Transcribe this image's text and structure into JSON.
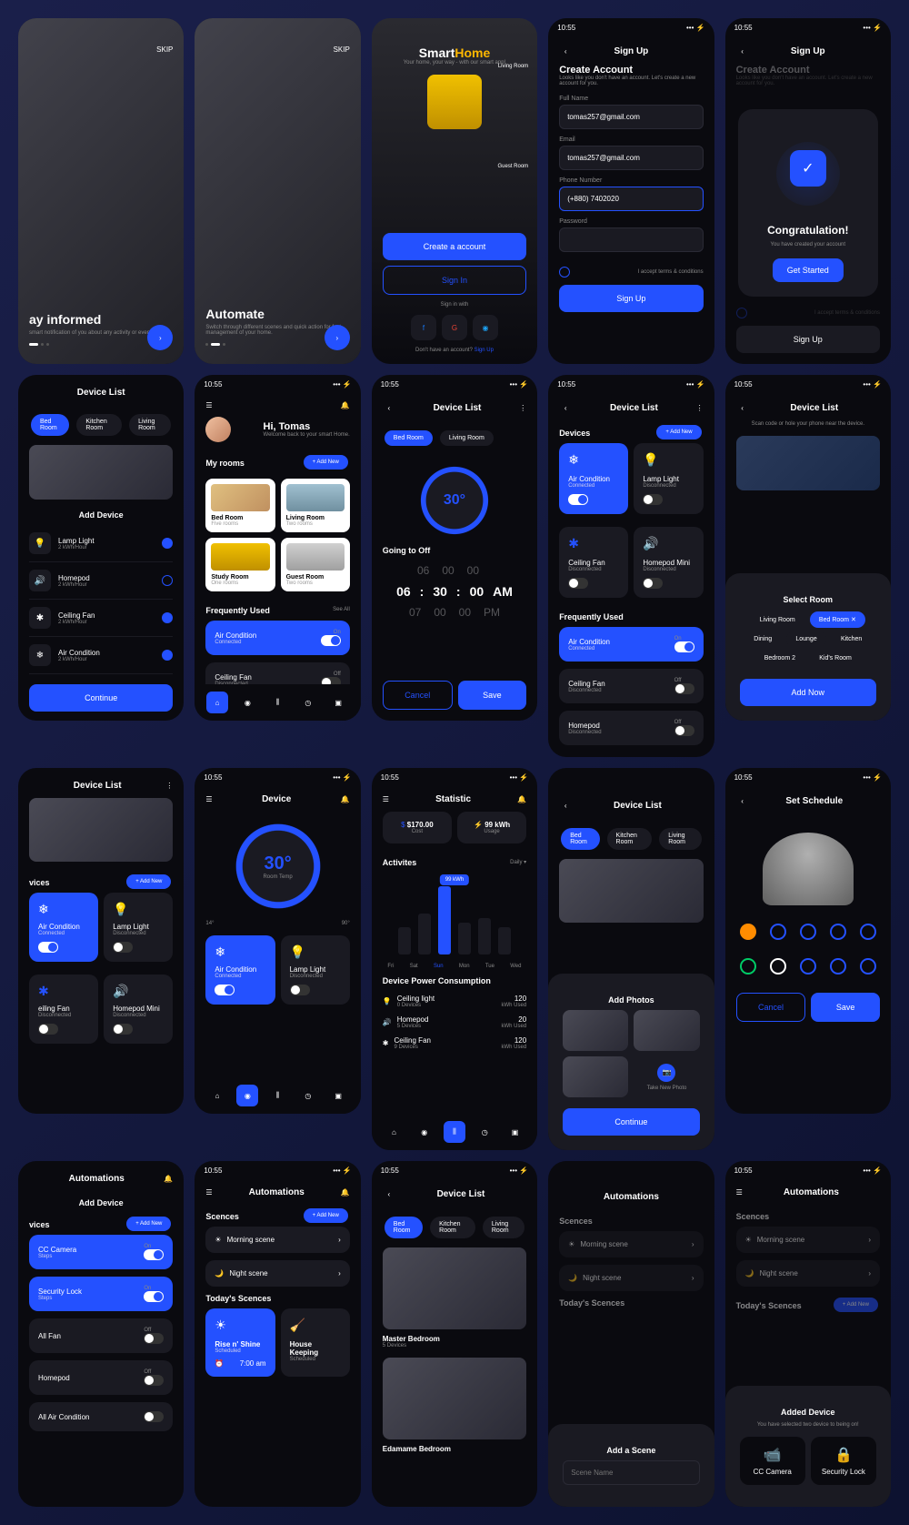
{
  "time": "10:55",
  "onboard1": {
    "skip": "SKIP",
    "title": "ay informed",
    "sub": "smart notification of you about any activity or events"
  },
  "onboard2": {
    "skip": "SKIP",
    "title": "Automate",
    "sub": "Switch through different scenes and quick action for fast management of your home."
  },
  "welcome": {
    "brand1": "Smart",
    "brand2": "Home",
    "tagline": "Your home, your way - with our smart app!",
    "room1": "Living Room",
    "room2": "Guest Room",
    "create": "Create a account",
    "signin": "Sign In",
    "signwith": "Sign in with",
    "noacct": "Don't have an account?",
    "signup": "Sign Up"
  },
  "signup": {
    "title": "Sign Up",
    "heading": "Create Account",
    "sub": "Looks like you don't have an account. Let's create a new account for you.",
    "name_label": "Full Name",
    "name_val": "tomas257@gmail.com",
    "email_label": "Email",
    "email_val": "tomas257@gmail.com",
    "phone_label": "Phone Number",
    "phone_val": "(+880) 7402020",
    "pwd_label": "Password",
    "terms": "I accept terms & conditions",
    "btn": "Sign Up"
  },
  "congrats": {
    "title": "Congratulation!",
    "sub": "You have created your account",
    "btn": "Get Started"
  },
  "devlist": {
    "title": "Device List",
    "addnew": "Add New",
    "continue": "Continue",
    "tabs": [
      "Bed Room",
      "Kitchen Room",
      "Living Room"
    ]
  },
  "adddevice": {
    "title": "Add Device",
    "devices": [
      {
        "name": "Lamp Light",
        "sub": "2 kWh/Hour"
      },
      {
        "name": "Homepod",
        "sub": "2 kWh/Hour"
      },
      {
        "name": "Ceiling Fan",
        "sub": "2 kWh/Hour"
      },
      {
        "name": "Air Condition",
        "sub": "2 kWh/Hour"
      }
    ]
  },
  "home": {
    "greeting": "Hi, Tomas",
    "welcome": "Welcome back to your smart Home.",
    "myrooms": "My rooms",
    "rooms": [
      {
        "name": "Bed Room",
        "sub": "Five rooms"
      },
      {
        "name": "Living Room",
        "sub": "Two rooms"
      },
      {
        "name": "Study Room",
        "sub": "One rooms"
      },
      {
        "name": "Guest Room",
        "sub": "Two rooms"
      }
    ],
    "freq": "Frequently Used",
    "seeall": "See All",
    "freq_items": [
      {
        "name": "Air Condition",
        "sub": "Connected",
        "state": "On"
      },
      {
        "name": "Ceiling Fan",
        "sub": "Disconnected",
        "state": "Off"
      }
    ]
  },
  "timer": {
    "title": "Device List",
    "temp": "30°",
    "going": "Going to Off",
    "rows": [
      [
        "06",
        "00",
        "00",
        ""
      ],
      [
        "06",
        "30",
        "00",
        "AM"
      ],
      [
        "07",
        "00",
        "00",
        "PM"
      ]
    ],
    "cancel": "Cancel",
    "save": "Save"
  },
  "devgrid": {
    "title": "Device List",
    "section": "Devices",
    "items": [
      {
        "name": "Air Condition",
        "sub": "Connected",
        "on": true
      },
      {
        "name": "Lamp Light",
        "sub": "Disconnected",
        "on": false
      },
      {
        "name": "Ceiling Fan",
        "sub": "Disconnected",
        "on": false
      },
      {
        "name": "Homepod Mini",
        "sub": "Disconnected",
        "on": false
      }
    ],
    "freq": "Frequently Used",
    "freq_items": [
      {
        "name": "Air Condition",
        "sub": "Connected",
        "state": "On"
      },
      {
        "name": "Ceiling Fan",
        "sub": "Disconnected",
        "state": "Off"
      },
      {
        "name": "Homepod",
        "sub": "Disconnected",
        "state": "Off"
      }
    ]
  },
  "scan": {
    "title": "Device List",
    "hint": "Scan code or hole your phone near the device.",
    "select": "Select Room",
    "rooms": [
      "Living Room",
      "Bed Room",
      "Dining",
      "Lounge",
      "Kitchen",
      "Bedroom 2",
      "Kid's Room"
    ],
    "btn": "Add Now"
  },
  "devices2": {
    "title": "Device List",
    "section": "vices",
    "items": [
      {
        "name": "Air Condition",
        "sub": "Connected"
      },
      {
        "name": "Lamp Light",
        "sub": "Disconnected"
      },
      {
        "name": "eiling Fan",
        "sub": "Disconnected"
      },
      {
        "name": "Homepod Mini",
        "sub": "Disconnected"
      }
    ]
  },
  "thermostat": {
    "title": "Device",
    "temp": "30°",
    "templabel": "Room Temp",
    "min": "14°",
    "max": "90°",
    "items": [
      {
        "name": "Air Condition",
        "sub": "Connected"
      },
      {
        "name": "Lamp Light",
        "sub": "Disconnected"
      }
    ]
  },
  "stats": {
    "title": "Statistic",
    "cost": "$170.00",
    "costlabel": "Cost",
    "usage": "99 kWh",
    "usagelabel": "Usage",
    "activities": "Activites",
    "daily": "Daily",
    "peak": "99 kWh",
    "days": [
      "Fri",
      "Sat",
      "Sun",
      "Mon",
      "Tue",
      "Wed"
    ],
    "consumption": "Device Power Consumption",
    "devices": [
      {
        "name": "Ceiling light",
        "sub": "0 Devices",
        "val": "120",
        "unit": "kWh Used"
      },
      {
        "name": "Homepod",
        "sub": "5 Devices",
        "val": "20",
        "unit": "kWh Used"
      },
      {
        "name": "Ceiling Fan",
        "sub": "9 Devices",
        "val": "120",
        "unit": "kWh Used"
      }
    ]
  },
  "addphotos": {
    "title": "Device List",
    "section": "Add Photos",
    "newphoto": "Take New Photo",
    "continue": "Continue"
  },
  "schedule": {
    "title": "Set Schedule",
    "cancel": "Cancel",
    "save": "Save",
    "colors": [
      "#ff8c00",
      "#2451ff",
      "#2451ff",
      "#2451ff",
      "#2451ff",
      "#00cc66",
      "#ffffff",
      "#2451ff",
      "#2451ff",
      "#2451ff"
    ]
  },
  "auto1": {
    "title": "Automations",
    "add": "Add Device",
    "section": "vices",
    "items": [
      {
        "name": "CC Camera",
        "sub": "Steps",
        "state": "On"
      },
      {
        "name": "Security Lock",
        "sub": "Steps",
        "state": "On"
      },
      {
        "name": "All Fan",
        "sub": "",
        "state": "Off"
      },
      {
        "name": "Homepod",
        "sub": "",
        "state": "Off"
      },
      {
        "name": "All Air Condition",
        "sub": ""
      }
    ]
  },
  "auto2": {
    "title": "Automations",
    "scenes": "Scences",
    "scene_items": [
      {
        "name": "Morning scene"
      },
      {
        "name": "Night scene"
      }
    ],
    "today": "Today's Scences",
    "cards": [
      {
        "name": "Rise n' Shine",
        "sub": "Scheduled",
        "time": "7:00 am"
      },
      {
        "name": "House Keeping",
        "sub": "Scheduled"
      }
    ]
  },
  "devlist2": {
    "title": "Device List",
    "rooms": [
      {
        "name": "Master Bedroom",
        "sub": "5 Devices"
      },
      {
        "name": "Edamame Bedroom"
      }
    ]
  },
  "addscene": {
    "title": "Automations",
    "scenes": "Scences",
    "items": [
      "Morning scene",
      "Night scene"
    ],
    "today": "Today's Scences",
    "modal": "Add a Scene",
    "name": "Scene Name"
  },
  "addeddevice": {
    "title": "Automations",
    "scenes": "Scences",
    "items": [
      "Morning scene",
      "Night scene"
    ],
    "today": "Today's Scences",
    "addnew": "Add New",
    "modal": "Added Device",
    "sub": "You have selected two device to being on!",
    "devices": [
      {
        "name": "CC Camera"
      },
      {
        "name": "Security Lock"
      }
    ]
  }
}
